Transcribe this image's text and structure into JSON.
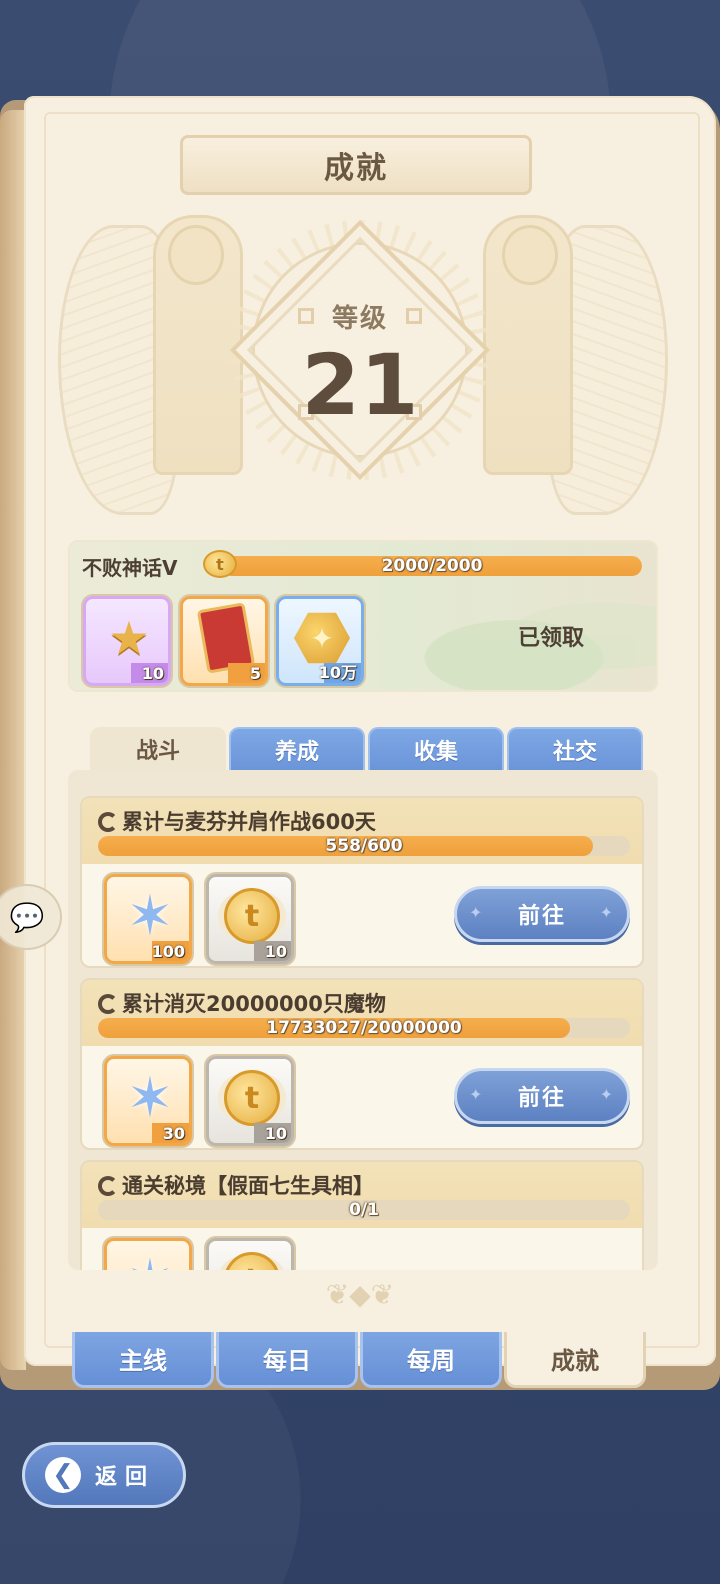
{
  "title": "成就",
  "level": {
    "label": "等级",
    "value": "21"
  },
  "summary": {
    "name": "不败神话V",
    "coin_icon_text": "t",
    "progress_text": "2000/2000",
    "progress_fraction": 1.0,
    "status": "已领取",
    "rewards": [
      {
        "icon": "gold-star-token-icon",
        "qty": "10",
        "rarity": "purple"
      },
      {
        "icon": "red-eye-card-icon",
        "qty": "5",
        "rarity": "orange"
      },
      {
        "icon": "gold-hex-coin-icon",
        "qty": "10万",
        "rarity": "blue"
      }
    ]
  },
  "category_tabs": [
    {
      "label": "战斗",
      "active": true
    },
    {
      "label": "养成",
      "active": false
    },
    {
      "label": "收集",
      "active": false
    },
    {
      "label": "社交",
      "active": false
    }
  ],
  "achievements": [
    {
      "title": "累计与麦芬并肩作战600天",
      "progress_text": "558/600",
      "progress_fraction": 0.93,
      "button": "前往",
      "rewards": [
        {
          "icon": "blue-crystal-star-icon",
          "qty": "100",
          "rarity": "orange"
        },
        {
          "icon": "winged-gold-coin-icon",
          "qty": "10",
          "rarity": "gray"
        }
      ]
    },
    {
      "title": "累计消灭20000000只魔物",
      "progress_text": "17733027/20000000",
      "progress_fraction": 0.887,
      "button": "前往",
      "rewards": [
        {
          "icon": "blue-crystal-star-icon",
          "qty": "30",
          "rarity": "orange"
        },
        {
          "icon": "winged-gold-coin-icon",
          "qty": "10",
          "rarity": "gray"
        }
      ]
    },
    {
      "title": "通关秘境【假面七生具相】",
      "progress_text": "0/1",
      "progress_fraction": 0.0,
      "button": "",
      "rewards": []
    }
  ],
  "main_tabs": [
    {
      "label": "主线",
      "active": false
    },
    {
      "label": "每日",
      "active": false
    },
    {
      "label": "每周",
      "active": false
    },
    {
      "label": "成就",
      "active": true
    }
  ],
  "back_button": {
    "label": "返回",
    "arrow": "❮"
  },
  "colors": {
    "background": "#34466a",
    "page": "#f7f0e1",
    "progress": "#f2a644",
    "tab_blue": "#6f98da",
    "button_blue": "#6a8ccb"
  }
}
